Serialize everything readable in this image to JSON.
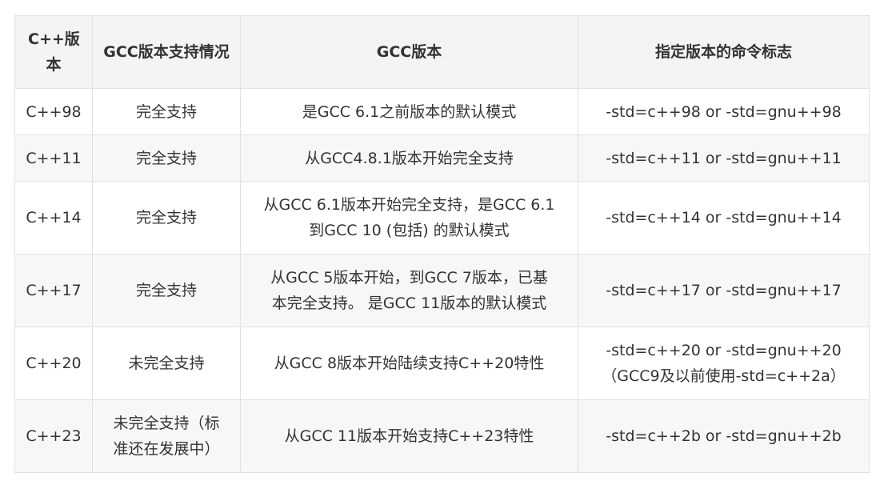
{
  "table": {
    "headers": [
      "C++版本",
      "GCC版本支持情况",
      "GCC版本",
      "指定版本的命令标志"
    ],
    "rows": [
      {
        "version": "C++98",
        "support": "完全支持",
        "gcc": "是GCC 6.1之前版本的默认模式",
        "flag": "-std=c++98 or -std=gnu++98"
      },
      {
        "version": "C++11",
        "support": "完全支持",
        "gcc": "从GCC4.8.1版本开始完全支持",
        "flag": "-std=c++11 or -std=gnu++11"
      },
      {
        "version": "C++14",
        "support": "完全支持",
        "gcc_lines": [
          "从GCC 6.1版本开始完全支持，是GCC 6.1",
          "到GCC 10 (包括) 的默认模式"
        ],
        "flag": "-std=c++14 or -std=gnu++14"
      },
      {
        "version": "C++17",
        "support": "完全支持",
        "gcc_lines": [
          "从GCC 5版本开始，到GCC 7版本，已基",
          "本完全支持。 是GCC 11版本的默认模式"
        ],
        "flag": "-std=c++17 or -std=gnu++17"
      },
      {
        "version": "C++20",
        "support": "未完全支持",
        "gcc": "从GCC 8版本开始陆续支持C++20特性",
        "flag_lines": [
          "-std=c++20 or -std=gnu++20",
          "（GCC9及以前使用-std=c++2a）"
        ]
      },
      {
        "version": "C++23",
        "support_lines": [
          "未完全支持（标",
          "准还在发展中）"
        ],
        "gcc": "从GCC 11版本开始支持C++23特性",
        "flag": "-std=c++2b or -std=gnu++2b"
      }
    ]
  }
}
